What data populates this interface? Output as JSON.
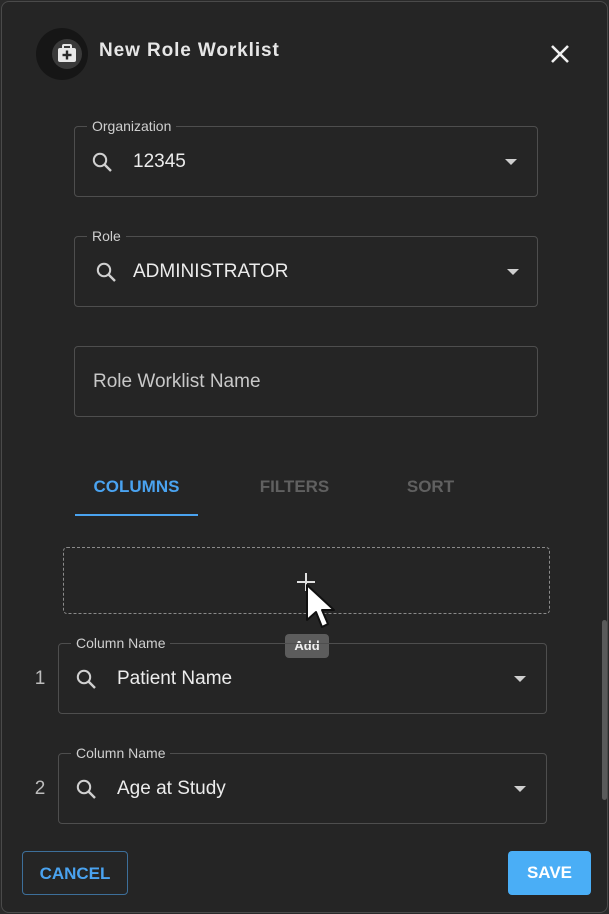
{
  "dialog": {
    "title": "New Role Worklist",
    "header_icon": "medical-bag-icon",
    "close_icon": "close-icon"
  },
  "organization": {
    "label": "Organization",
    "value": "12345"
  },
  "role": {
    "label": "Role",
    "value": "ADMINISTRATOR"
  },
  "worklist_name": {
    "placeholder": "Role Worklist Name",
    "value": ""
  },
  "tabs": [
    {
      "label": "COLUMNS",
      "active": true
    },
    {
      "label": "FILTERS",
      "active": false
    },
    {
      "label": "SORT",
      "active": false
    }
  ],
  "add_zone": {
    "tooltip": "Add",
    "icon": "plus-icon"
  },
  "columns": [
    {
      "index": "1",
      "label": "Column Name",
      "value": "Patient Name"
    },
    {
      "index": "2",
      "label": "Column Name",
      "value": "Age at Study"
    }
  ],
  "footer": {
    "cancel_label": "CANCEL",
    "save_label": "SAVE"
  },
  "colors": {
    "accent": "#4aa3f0",
    "save_bg": "#4aaef6",
    "background": "#252525"
  }
}
